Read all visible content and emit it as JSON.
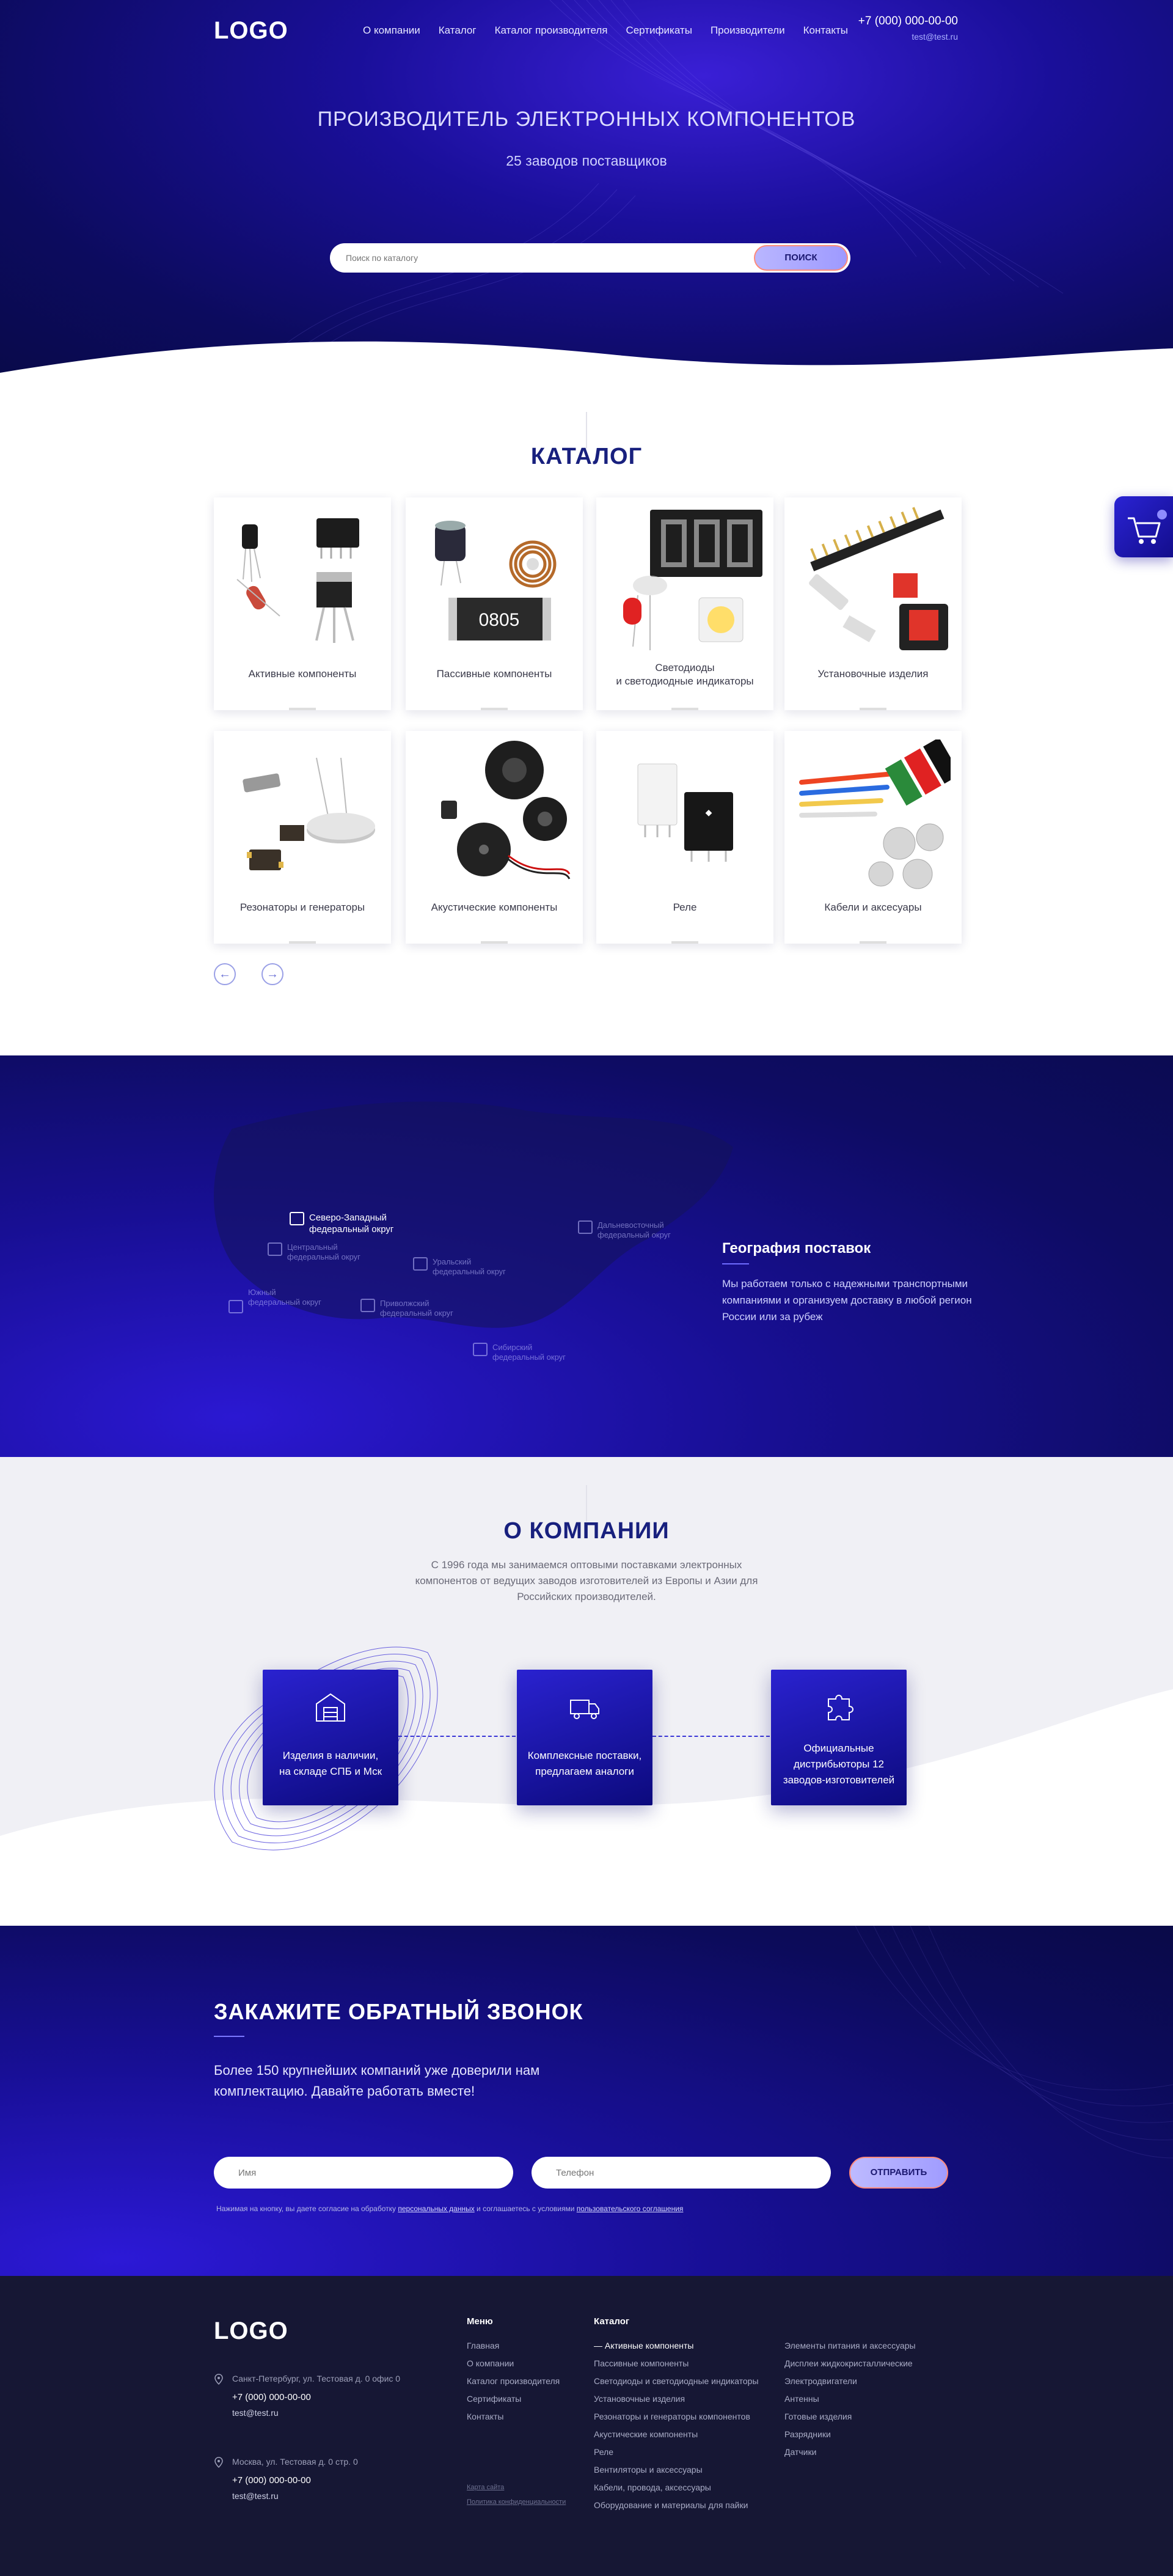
{
  "header": {
    "logo": "LOGO",
    "nav": [
      "О компании",
      "Каталог",
      "Каталог производителя",
      "Сертификаты",
      "Производители",
      "Контакты"
    ],
    "phone": "+7 (000) 000-00-00",
    "email": "test@test.ru"
  },
  "hero": {
    "title": "ПРОИЗВОДИТЕЛЬ ЭЛЕКТРОННЫХ КОМПОНЕНТОВ",
    "subtitle": "25 заводов поставщиков",
    "search_placeholder": "Поиск по каталогу",
    "search_button": "ПОИСК"
  },
  "catalog": {
    "title": "КАТАЛОГ",
    "cards": [
      {
        "label": "Активные компоненты"
      },
      {
        "label": "Пассивные компоненты"
      },
      {
        "label": "Светодиоды\nи светодиодные  индикаторы"
      },
      {
        "label": "Установочные изделия"
      },
      {
        "label": "Резонаторы и генераторы"
      },
      {
        "label": "Акустические компоненты"
      },
      {
        "label": "Реле"
      },
      {
        "label": "Кабели и аксесуары"
      }
    ],
    "prev_icon": "arrow-left-icon",
    "next_icon": "arrow-right-icon"
  },
  "geo": {
    "regions": [
      {
        "name": "Северо-Западный\nфедеральный округ",
        "active": true
      },
      {
        "name": "Центральный\nфедеральный округ",
        "active": false
      },
      {
        "name": "Уральский\nфедеральный округ",
        "active": false
      },
      {
        "name": "Дальневосточный\nфедеральный округ",
        "active": false
      },
      {
        "name": "Южный\nфедеральный округ",
        "active": false
      },
      {
        "name": "Приволжский\nфедеральный округ",
        "active": false
      },
      {
        "name": "Сибирский\nфедеральный округ",
        "active": false
      }
    ],
    "title": "География поставок",
    "text": "Мы работаем только с надежными транспортными компаниями и организуем доставку в любой регион России или за рубеж"
  },
  "about": {
    "title": "О КОМПАНИИ",
    "text": "С 1996 года мы занимаемся оптовыми поставками электронных компонентов от ведущих заводов изготовителей из Европы и Азии для Российских производителей.",
    "features": [
      {
        "icon": "warehouse-icon",
        "text": "Изделия в наличии,\nна складе СПБ и Мск"
      },
      {
        "icon": "truck-icon",
        "text": "Комплексные поставки,\nпредлагаем аналоги"
      },
      {
        "icon": "puzzle-icon",
        "text": "Официальные\nдистрибьюторы 12\nзаводов-изготовителей"
      }
    ]
  },
  "callback": {
    "title": "ЗАКАЖИТЕ ОБРАТНЫЙ ЗВОНОК",
    "text": "Более 150 крупнейших компаний уже доверили нам комплектацию. Давайте работать вместе!",
    "name_placeholder": "Имя",
    "phone_placeholder": "Телефон",
    "send_button": "ОТПРАВИТЬ",
    "consent_prefix": "Нажимая на кнопку, вы даете согласие на обработку ",
    "consent_link1": "персональных данных",
    "consent_middle": " и соглашаетесь c условиями ",
    "consent_link2": "пользовательского соглашения"
  },
  "footer": {
    "logo": "LOGO",
    "offices": [
      {
        "address": "Санкт-Петербург, ул. Тестовая д. 0 офис 0",
        "phone": "+7 (000) 000-00-00",
        "email": "test@test.ru"
      },
      {
        "address": "Москва, ул. Тестовая д. 0 стр. 0",
        "phone": "+7 (000) 000-00-00",
        "email": "test@test.ru"
      }
    ],
    "menu_title": "Меню",
    "menu": [
      "Главная",
      "О компании",
      "Каталог производителя",
      "Сертификаты",
      "Контакты"
    ],
    "catalog_title": "Каталог",
    "catalog_col1": [
      "— Активные компоненты",
      "Пассивные компоненты",
      "Светодиоды и светодиодные индикаторы",
      "Установочные изделия",
      "Резонаторы и генераторы компонентов",
      "Акустические компоненты",
      "Реле",
      "Вентиляторы и аксессуары",
      "Кабели, провода, аксессуары",
      "Оборудование и материалы для пайки"
    ],
    "catalog_col2": [
      "Элементы питания и аксессуары",
      "Дисплеи жидкокристаллические",
      "Электродвигатели",
      "Антенны",
      "Готовые изделия",
      "Разрядники",
      "Датчики"
    ],
    "site_map": "Карта сайта",
    "privacy": "Политика конфиденциальности"
  },
  "colors": {
    "brand_dark": "#0c0b5e",
    "brand_accent": "#2a23d4",
    "title_blue": "#18207e",
    "button_border": "#ff8a7a"
  }
}
